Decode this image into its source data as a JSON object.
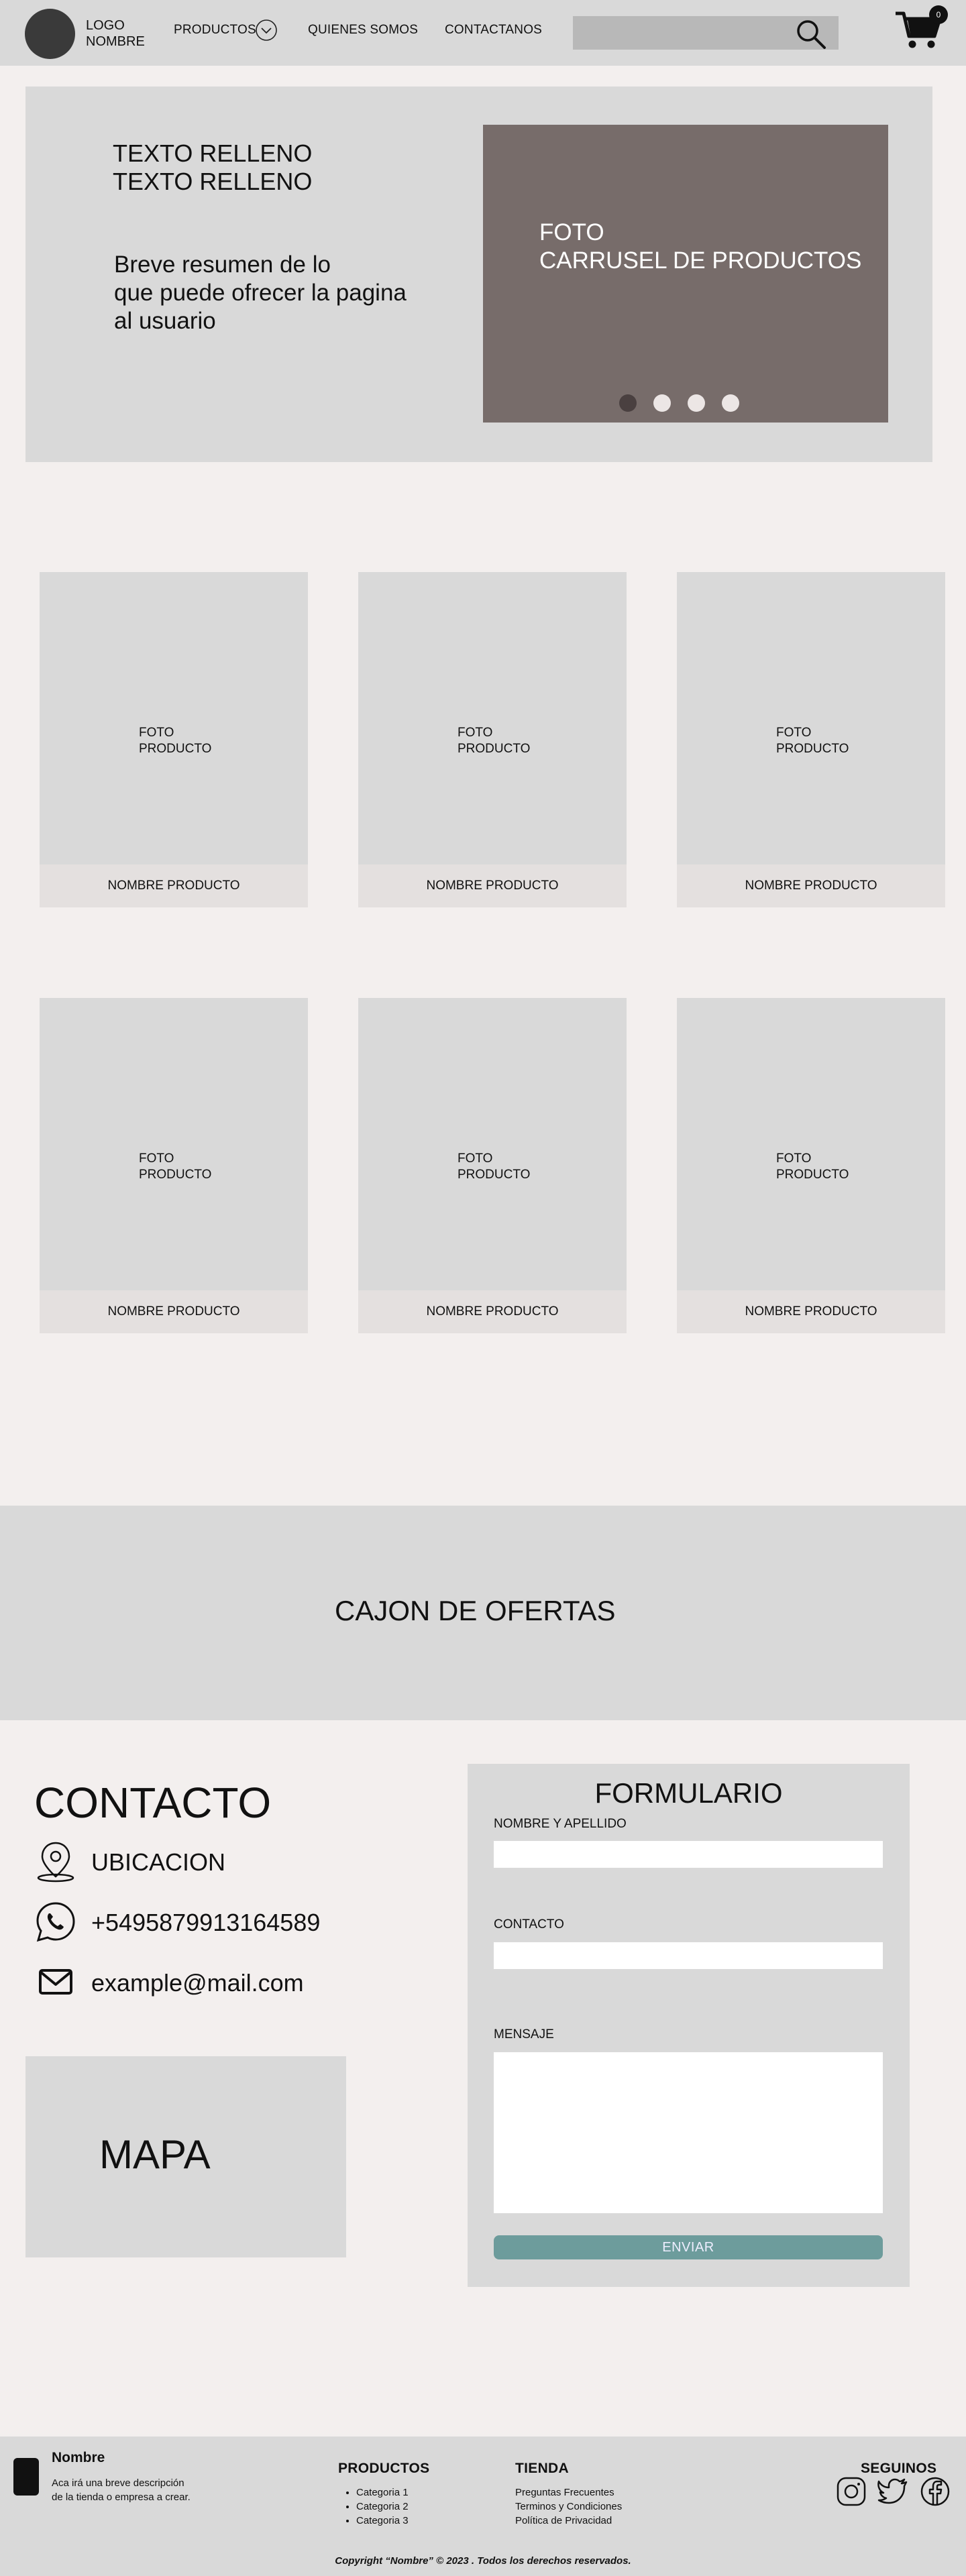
{
  "navbar": {
    "logo_text": "LOGO\nNOMBRE",
    "items": [
      "PRODUCTOS",
      "QUIENES SOMOS",
      "CONTACTANOS"
    ],
    "search": {
      "placeholder": "",
      "value": ""
    },
    "cart_badge": "0",
    "icons": {
      "search": "search-icon",
      "cart": "cart-icon",
      "dropdown": "chevron-down-icon"
    }
  },
  "hero": {
    "title": "TEXTO RELLENO\nTEXTO RELLENO",
    "summary": "Breve resumen de lo\nque puede ofrecer la pagina\nal usuario",
    "carousel_text": "FOTO\nCARRUSEL DE PRODUCTOS",
    "active_slide": 1,
    "slides": 4
  },
  "products": [
    {
      "photo": "FOTO\nPRODUCTO",
      "name": "NOMBRE PRODUCTO"
    },
    {
      "photo": "FOTO\nPRODUCTO",
      "name": "NOMBRE PRODUCTO"
    },
    {
      "photo": "FOTO\nPRODUCTO",
      "name": "NOMBRE PRODUCTO"
    },
    {
      "photo": "FOTO\nPRODUCTO",
      "name": "NOMBRE PRODUCTO"
    },
    {
      "photo": "FOTO\nPRODUCTO",
      "name": "NOMBRE PRODUCTO"
    },
    {
      "photo": "FOTO\nPRODUCTO",
      "name": "NOMBRE PRODUCTO"
    }
  ],
  "offers": {
    "title": "CAJON DE OFERTAS"
  },
  "contact": {
    "title": "CONTACTO",
    "location": "UBICACION",
    "phone": "+5495879913164589",
    "email": "example@mail.com",
    "map_label": "MAPA",
    "icons": [
      "location-pin-icon",
      "whatsapp-icon",
      "mail-icon"
    ]
  },
  "form": {
    "title": "FORMULARIO",
    "name_label": "NOMBRE Y APELLIDO",
    "contact_label": "CONTACTO",
    "message_label": "MENSAJE",
    "name_value": "",
    "contact_value": "",
    "message_value": "",
    "submit_label": "ENVIAR"
  },
  "footer": {
    "name": "Nombre",
    "description": "Aca irá una breve descripción\nde la tienda o empresa a crear.",
    "products_head": "PRODUCTOS",
    "categories": [
      "Categoria 1",
      "Categoria 2",
      "Categoria 3"
    ],
    "store_head": "TIENDA",
    "store_links": [
      "Preguntas Frecuentes",
      "Terminos y Condiciones",
      "Política de Privacidad"
    ],
    "follow_head": "SEGUINOS",
    "social_icons": [
      "instagram-icon",
      "twitter-icon",
      "facebook-icon"
    ],
    "copyright": "Copyright “Nombre”  © 2023 .   Todos los derechos reservados."
  },
  "colors": {
    "page_bg": "#f3efee",
    "panel_bg": "#d9d9d9",
    "carousel_bg": "#776c6a",
    "button_accent": "#6d9c9c"
  }
}
